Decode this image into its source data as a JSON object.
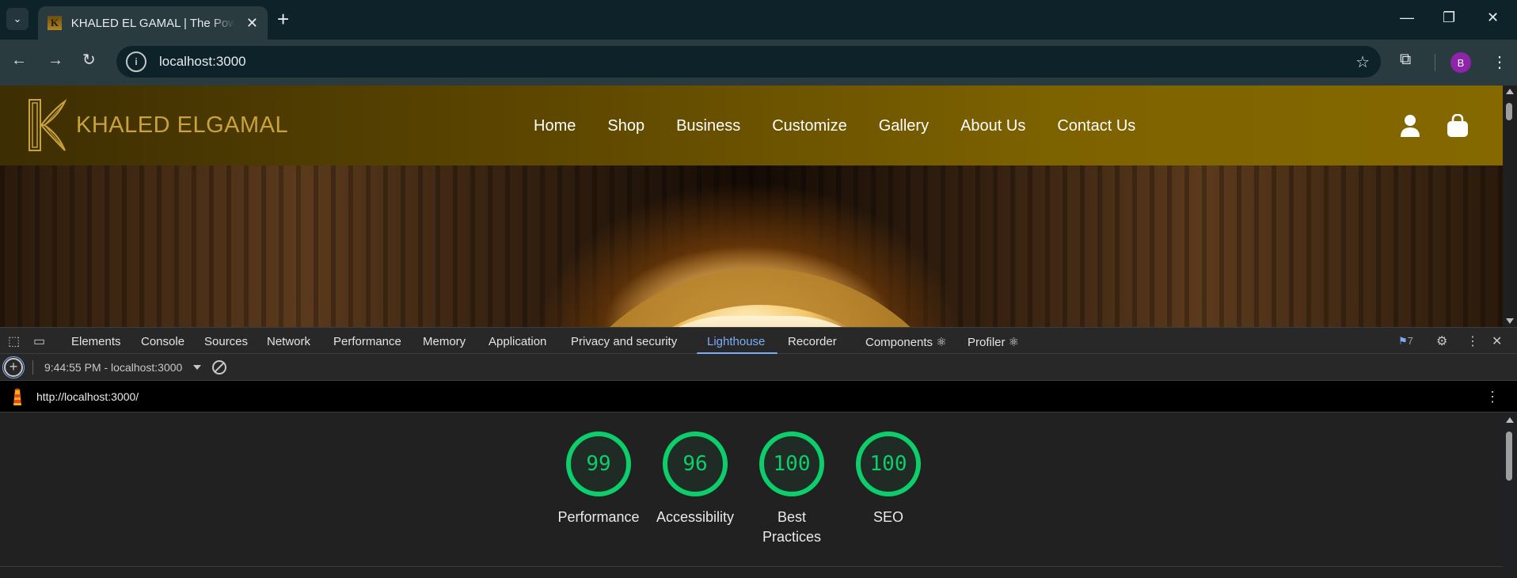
{
  "browser": {
    "tab_title": "KHALED EL GAMAL | The Power of Egyptian Art",
    "tab_favicon": "K",
    "url": "localhost:3000",
    "profile_initial": "B"
  },
  "site": {
    "logo_text": "KHALED ELGAMAL",
    "nav": [
      "Home",
      "Shop",
      "Business",
      "Customize",
      "Gallery",
      "About Us",
      "Contact Us"
    ]
  },
  "devtools": {
    "tabs": [
      "Elements",
      "Console",
      "Sources",
      "Network",
      "Performance",
      "Memory",
      "Application",
      "Privacy and security",
      "Lighthouse",
      "Recorder",
      "Components ⚛",
      "Profiler ⚛"
    ],
    "active_tab": "Lighthouse",
    "issues_count": "7",
    "report_select": "9:44:55 PM - localhost:3000"
  },
  "lighthouse": {
    "url": "http://localhost:3000/",
    "scores": [
      {
        "label": "Performance",
        "value": "99"
      },
      {
        "label": "Accessibility",
        "value": "96"
      },
      {
        "label": "Best Practices",
        "value": "100"
      },
      {
        "label": "SEO",
        "value": "100"
      }
    ],
    "color_pass": "#0cce6b"
  }
}
